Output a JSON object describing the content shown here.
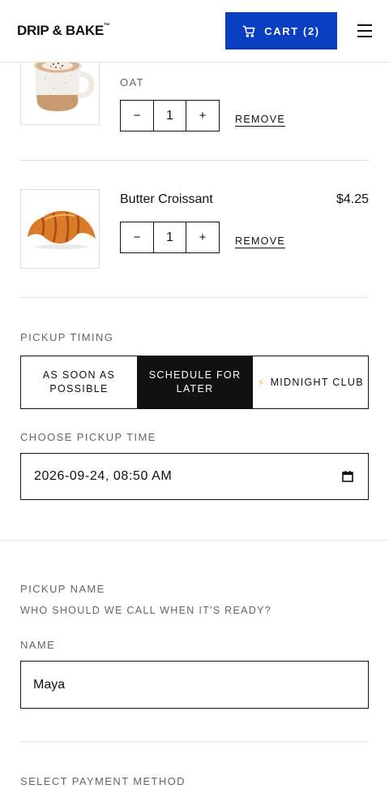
{
  "header": {
    "logo": "DRIP & BAKE",
    "logo_mark": "™",
    "cart_label": "CART (2)",
    "cart_icon": "cart-icon",
    "menu_icon": "hamburger-menu-icon"
  },
  "cart_items": [
    {
      "name": "",
      "option": "OAT",
      "price": "",
      "quantity": "1",
      "decrement": "−",
      "increment": "+",
      "remove_label": "REMOVE",
      "image": "latte-mug"
    },
    {
      "name": "Butter Croissant",
      "option": "",
      "price": "$4.25",
      "quantity": "1",
      "decrement": "−",
      "increment": "+",
      "remove_label": "REMOVE",
      "image": "croissant"
    }
  ],
  "pickup_timing": {
    "heading": "PICKUP TIMING",
    "options": [
      "AS SOON AS POSSIBLE",
      "SCHEDULE FOR LATER",
      "MIDNIGHT CLUB"
    ],
    "selected": "SCHEDULE FOR LATER",
    "bolt_icon": "lightning-icon",
    "time_label": "CHOOSE PICKUP TIME",
    "time_value": "2026-09-24, 08:50 AM",
    "calendar_icon": "calendar-icon"
  },
  "pickup_name": {
    "heading": "PICKUP NAME",
    "subheading": "WHO SHOULD WE CALL WHEN IT'S READY?",
    "field_label": "NAME",
    "field_value": "Maya"
  },
  "payment": {
    "heading": "SELECT PAYMENT METHOD"
  },
  "colors": {
    "accent": "#0a3fc2",
    "selected_segment": "#111111",
    "bolt": "#e7c744"
  }
}
